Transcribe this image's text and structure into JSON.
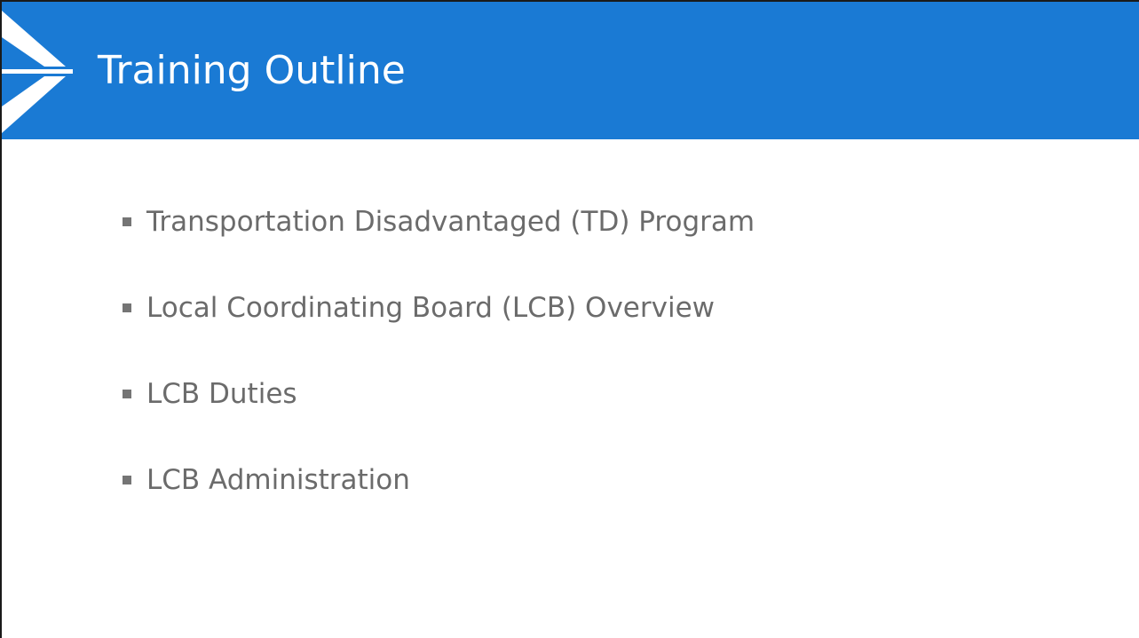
{
  "slide": {
    "title": "Training Outline",
    "bullets": [
      "Transportation Disadvantaged (TD) Program",
      "Local Coordinating Board (LCB) Overview",
      "LCB Duties",
      "LCB Administration"
    ]
  },
  "colors": {
    "header_background": "#1a7ad4",
    "title_text": "#ffffff",
    "bullet_text": "#6b6b6b",
    "bullet_marker": "#757575"
  },
  "icons": {
    "logo": "arrow-chevron-logo-icon"
  }
}
